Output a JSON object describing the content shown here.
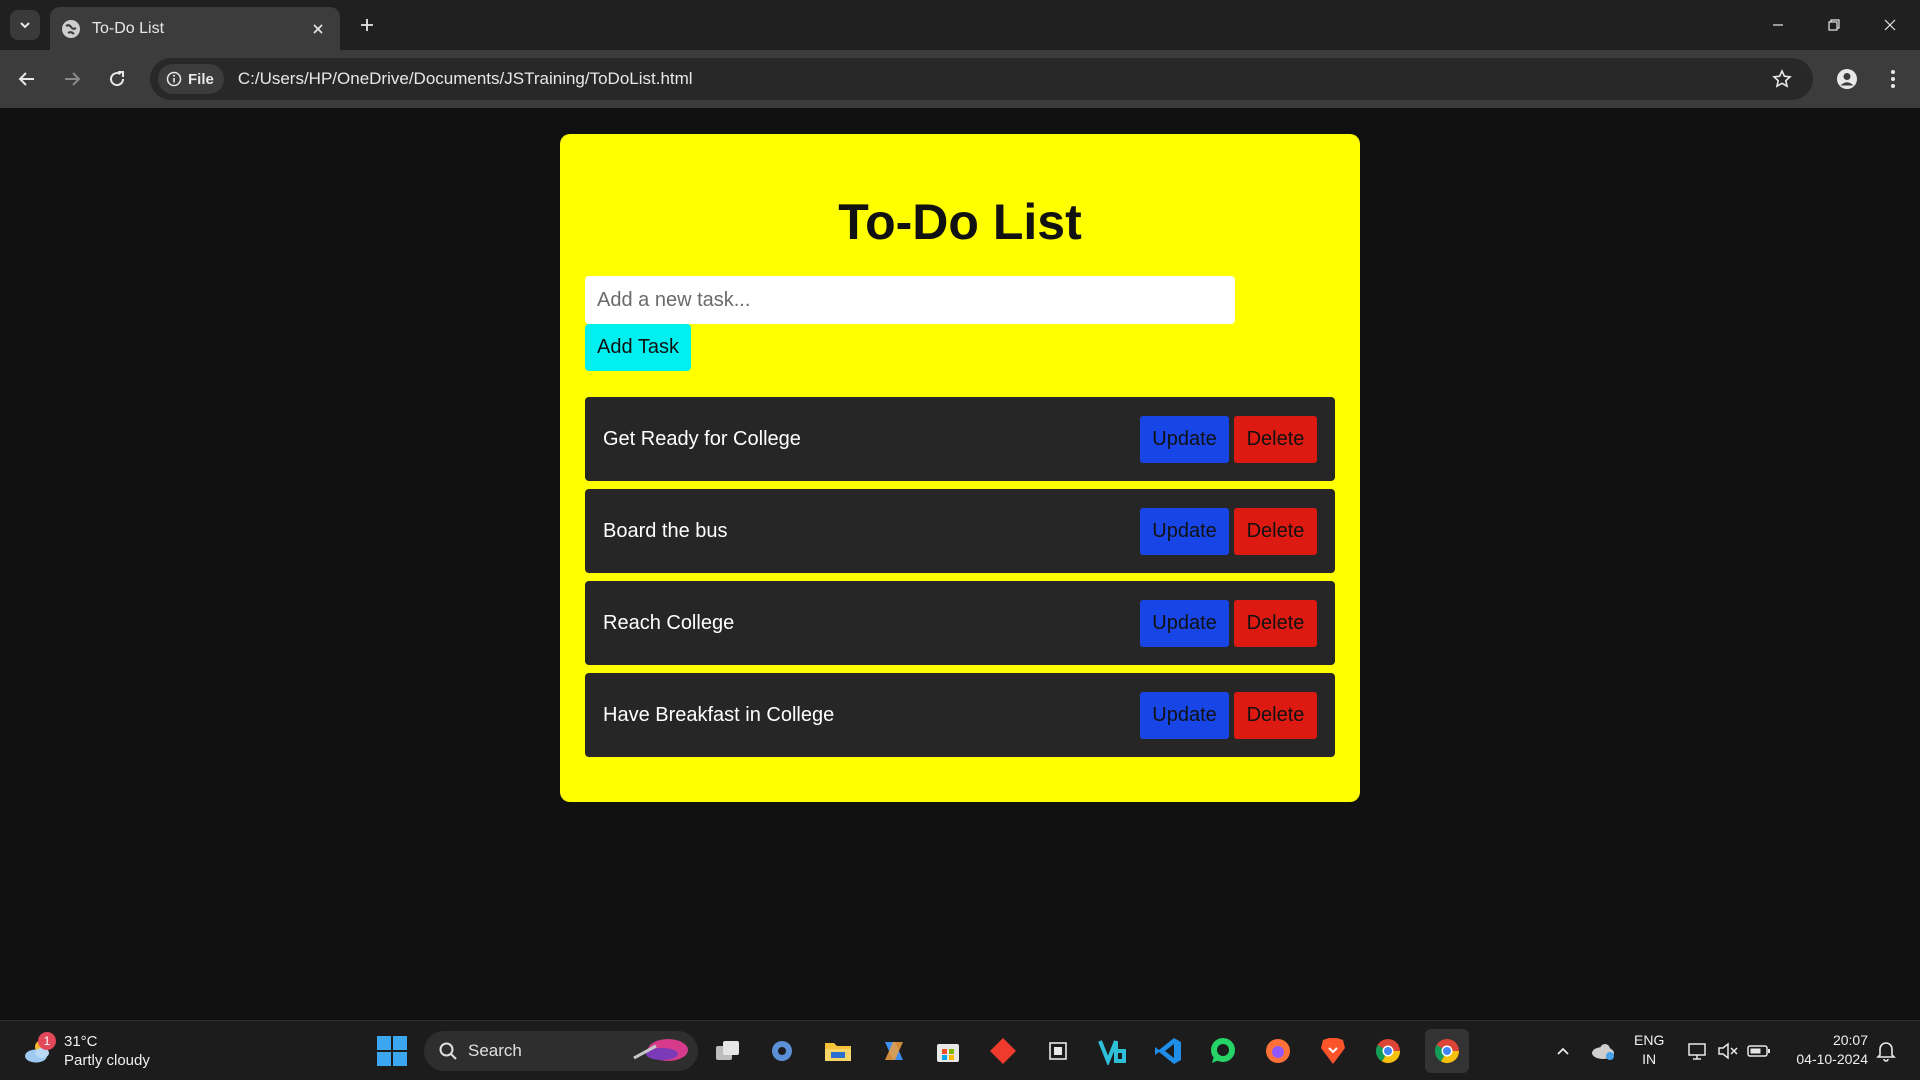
{
  "browser": {
    "tab_title": "To-Do List",
    "omnibox_chip": "File",
    "url": "C:/Users/HP/OneDrive/Documents/JSTraining/ToDoList.html"
  },
  "app": {
    "title": "To-Do List",
    "input_placeholder": "Add a new task...",
    "add_button": "Add Task",
    "tasks": [
      {
        "text": "Get Ready for College",
        "update": "Update",
        "delete": "Delete"
      },
      {
        "text": "Board the bus",
        "update": "Update",
        "delete": "Delete"
      },
      {
        "text": "Reach College",
        "update": "Update",
        "delete": "Delete"
      },
      {
        "text": "Have Breakfast in College",
        "update": "Update",
        "delete": "Delete"
      }
    ]
  },
  "colors": {
    "card": "#ffff00",
    "add_button": "#00f0f0",
    "update_button": "#1846e6",
    "delete_button": "#dd1a12",
    "task_row": "#262626",
    "page_bg": "#111111"
  },
  "taskbar": {
    "weather_badge": "1",
    "temperature": "31°C",
    "condition": "Partly cloudy",
    "search_label": "Search",
    "lang_primary": "ENG",
    "lang_secondary": "IN",
    "time": "20:07",
    "date": "04-10-2024"
  },
  "icons": {
    "tab_search": "chevron-down-icon",
    "favicon": "globe-icon",
    "close": "close-icon",
    "new_tab": "plus-icon",
    "back": "back-arrow-icon",
    "forward": "forward-arrow-icon",
    "reload": "reload-icon",
    "info": "info-icon",
    "bookmark": "star-icon",
    "profile": "profile-icon",
    "menu": "kebab-menu-icon"
  }
}
